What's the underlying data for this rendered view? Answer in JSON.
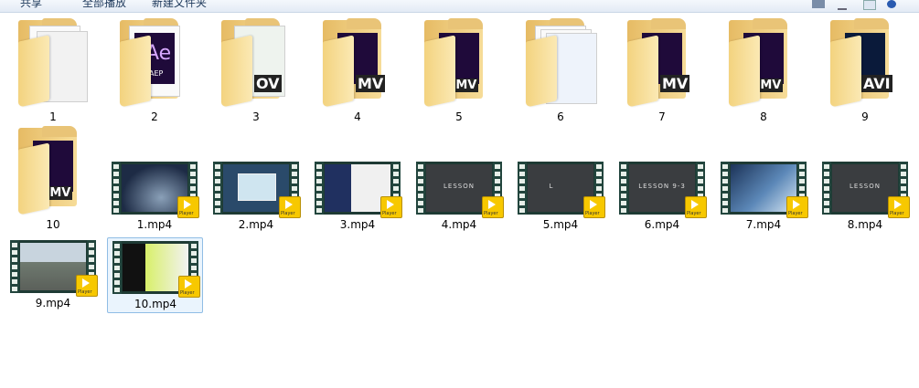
{
  "toolbar": {
    "items": [
      "共享",
      "全部播放",
      "新建文件夹"
    ]
  },
  "folders": [
    {
      "name": "1",
      "content": "blank"
    },
    {
      "name": "2",
      "content": "ae",
      "ae_label": "Ae",
      "ae_sub": "AEP"
    },
    {
      "name": "3",
      "content": "mov",
      "badge": "OV"
    },
    {
      "name": "4",
      "content": "mov",
      "badge": "MV"
    },
    {
      "name": "5",
      "content": "wmv",
      "badge": "WMV"
    },
    {
      "name": "6",
      "content": "docs"
    },
    {
      "name": "7",
      "content": "mov",
      "badge": "MV"
    },
    {
      "name": "8",
      "content": "wmv",
      "badge": "WMV"
    },
    {
      "name": "9",
      "content": "avi",
      "badge": "AVI"
    },
    {
      "name": "10",
      "content": "wmv",
      "badge": "WMV"
    }
  ],
  "videos": [
    {
      "name": "1.mp4",
      "scene": "mountain",
      "caption": ""
    },
    {
      "name": "2.mp4",
      "scene": "window",
      "caption": ""
    },
    {
      "name": "3.mp4",
      "scene": "poster",
      "caption": ""
    },
    {
      "name": "4.mp4",
      "scene": "dark",
      "caption": "LESSON"
    },
    {
      "name": "5.mp4",
      "scene": "dark",
      "caption": "L"
    },
    {
      "name": "6.mp4",
      "scene": "dark",
      "caption": "LESSON 9-3"
    },
    {
      "name": "7.mp4",
      "scene": "sky",
      "caption": ""
    },
    {
      "name": "8.mp4",
      "scene": "dark",
      "caption": "LESSON"
    },
    {
      "name": "9.mp4",
      "scene": "street",
      "caption": ""
    },
    {
      "name": "10.mp4",
      "scene": "studio",
      "caption": ""
    }
  ],
  "player_badge": "Player",
  "selected_item": "10.mp4",
  "colors": {
    "selection_border": "#90bde5",
    "selection_fill": "#eaf4fd",
    "folder": "#f3d37f",
    "player_badge": "#f7c800"
  }
}
